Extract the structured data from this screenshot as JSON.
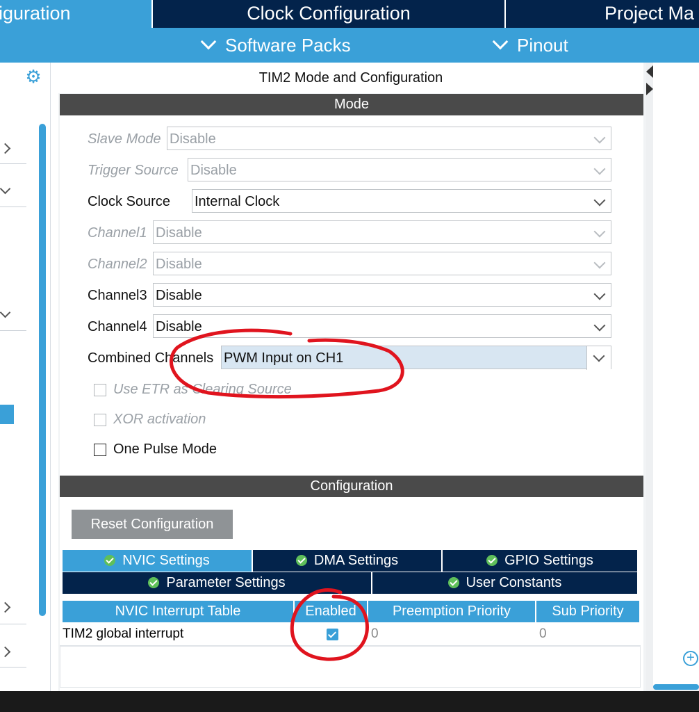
{
  "top_tabs": [
    {
      "label": "Pinout & Configuration",
      "visible_text": "iguration"
    },
    {
      "label": "Clock Configuration"
    },
    {
      "label": "Project Ma"
    }
  ],
  "sub_menu": [
    {
      "label": "Software Packs"
    },
    {
      "label": "Pinout"
    }
  ],
  "panel": {
    "title": "TIM2 Mode and Configuration",
    "mode_header": "Mode",
    "config_header": "Configuration"
  },
  "mode_fields": [
    {
      "label": "Slave Mode",
      "value": "Disable",
      "enabled": false
    },
    {
      "label": "Trigger Source",
      "value": "Disable",
      "enabled": false
    },
    {
      "label": "Clock Source",
      "value": "Internal Clock",
      "enabled": true
    },
    {
      "label": "Channel1",
      "value": "Disable",
      "enabled": false
    },
    {
      "label": "Channel2",
      "value": "Disable",
      "enabled": false
    },
    {
      "label": "Channel3",
      "value": "Disable",
      "enabled": true
    },
    {
      "label": "Channel4",
      "value": "Disable",
      "enabled": true
    },
    {
      "label": "Combined Channels",
      "value": "PWM Input on CH1",
      "enabled": true,
      "highlighted": true
    }
  ],
  "checkboxes": [
    {
      "label": "Use ETR as Clearing Source",
      "enabled": false,
      "checked": false
    },
    {
      "label": "XOR activation",
      "enabled": false,
      "checked": false
    },
    {
      "label": "One Pulse Mode",
      "enabled": true,
      "checked": false
    }
  ],
  "reset_button": "Reset Configuration",
  "config_tabs_row1": [
    {
      "label": "NVIC Settings",
      "active": true
    },
    {
      "label": "DMA Settings",
      "active": false
    },
    {
      "label": "GPIO Settings",
      "active": false
    }
  ],
  "config_tabs_row2": [
    {
      "label": "Parameter Settings",
      "active": false
    },
    {
      "label": "User Constants",
      "active": false
    }
  ],
  "nvic_table": {
    "headers": [
      "NVIC Interrupt Table",
      "Enabled",
      "Preemption Priority",
      "Sub Priority"
    ],
    "rows": [
      {
        "name": "TIM2 global interrupt",
        "enabled": true,
        "preemption": "0",
        "sub": "0"
      }
    ]
  },
  "colors": {
    "accent": "#3aa0d8",
    "navy": "#03234b",
    "header_gray": "#4a4a4a",
    "annotation_red": "#e0141e"
  },
  "icons": [
    "gear-icon",
    "chevron-down-icon",
    "check-circle-icon",
    "zoom-in-icon"
  ]
}
